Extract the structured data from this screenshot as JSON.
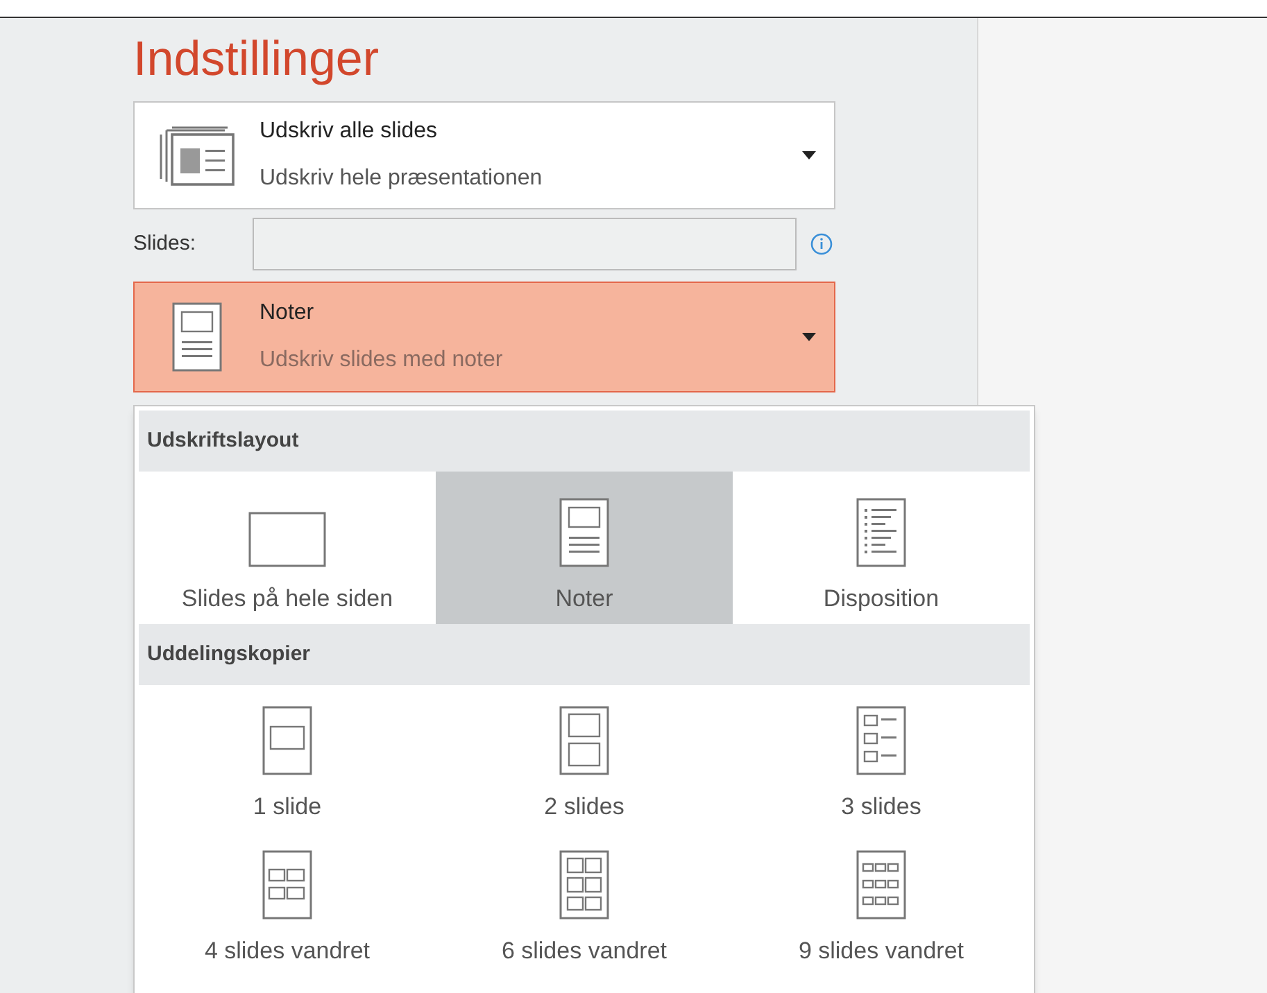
{
  "title": "Indstillinger",
  "print_range": {
    "kind": "all-slides",
    "label": "Udskriv alle slides",
    "description": "Udskriv hele præsentationen"
  },
  "slides_field": {
    "label": "Slides:"
  },
  "layout_dropdown": {
    "kind": "notes",
    "label": "Noter",
    "description": "Udskriv slides med noter",
    "expanded": true
  },
  "menu": {
    "sections": [
      {
        "heading": "Udskriftslayout",
        "items": [
          {
            "kind": "full",
            "label": "Slides på hele siden",
            "selected": false
          },
          {
            "kind": "notes",
            "label": "Noter",
            "selected": true
          },
          {
            "kind": "outline",
            "label": "Disposition",
            "selected": false
          }
        ]
      },
      {
        "heading": "Uddelingskopier",
        "items": [
          {
            "kind": "h1",
            "label": "1 slide",
            "selected": false
          },
          {
            "kind": "h2",
            "label": "2 slides",
            "selected": false
          },
          {
            "kind": "h3",
            "label": "3 slides",
            "selected": false
          },
          {
            "kind": "h4",
            "label": "4 slides vandret",
            "selected": false
          },
          {
            "kind": "h6",
            "label": "6 slides vandret",
            "selected": false
          },
          {
            "kind": "h9",
            "label": "9 slides vandret",
            "selected": false
          }
        ]
      }
    ]
  }
}
